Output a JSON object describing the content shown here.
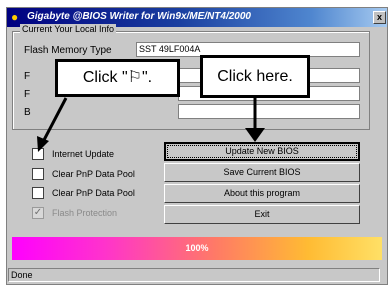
{
  "window": {
    "title": "Gigabyte @BIOS Writer for Win9x/ME/NT4/2000",
    "close_glyph": "x"
  },
  "info_group": {
    "legend": "Current Your Local Info",
    "rows": [
      {
        "label": "Flash Memory Type",
        "value": "SST 49LF004A"
      },
      {
        "label": "F",
        "value": ""
      },
      {
        "label": "F",
        "value": ""
      },
      {
        "label": "B",
        "value": ""
      }
    ]
  },
  "callouts": {
    "left": "Click \"⚐\".",
    "right": "Click here."
  },
  "options": [
    {
      "label": "Internet Update",
      "checked": false,
      "enabled": true
    },
    {
      "label": "Clear PnP Data Pool",
      "checked": false,
      "enabled": true
    },
    {
      "label": "Clear PnP Data Pool",
      "checked": false,
      "enabled": true
    },
    {
      "label": "Flash Protection",
      "checked": true,
      "enabled": false
    }
  ],
  "buttons": {
    "update": "Update New BIOS",
    "save": "Save Current BIOS",
    "about": "About this program",
    "exit": "Exit"
  },
  "progress": {
    "text": "100%",
    "value": 1.0
  },
  "status": {
    "text": "Done"
  },
  "icons": {
    "app": "app-icon",
    "close": "close-icon",
    "arrow_left": "arrow-down-left-icon",
    "arrow_right": "arrow-down-icon"
  }
}
